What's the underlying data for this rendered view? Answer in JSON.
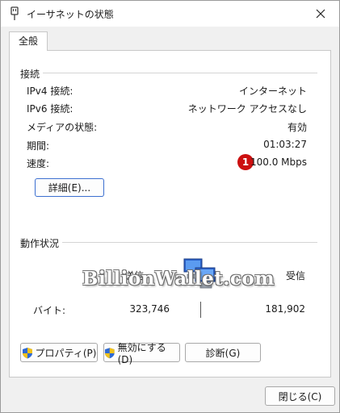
{
  "window": {
    "title": "イーサネットの状態"
  },
  "tabs": [
    {
      "label": "全般"
    }
  ],
  "connection": {
    "heading": "接続",
    "rows": [
      {
        "label": "IPv4 接続:",
        "value": "インターネット"
      },
      {
        "label": "IPv6 接続:",
        "value": "ネットワーク アクセスなし"
      },
      {
        "label": "メディアの状態:",
        "value": "有効"
      },
      {
        "label": "期間:",
        "value": "01:03:27"
      },
      {
        "label": "速度:",
        "value": "100.0 Mbps"
      }
    ],
    "badge": "1",
    "details_button": "詳細(E)..."
  },
  "activity": {
    "heading": "動作状況",
    "sent_label": "送信",
    "received_label": "受信",
    "bytes_label": "バイト:",
    "sent_value": "323,746",
    "received_value": "181,902"
  },
  "watermark": "BillionWallet.com",
  "buttons": {
    "properties": "プロパティ(P)",
    "disable": "無効にする(D)",
    "diagnose": "診断(G)",
    "close": "閉じる(C)"
  },
  "icons": {
    "window": "ethernet-plug-icon",
    "properties_shield": "uac-shield-icon",
    "disable_shield": "uac-shield-icon",
    "network": "network-computers-icon"
  }
}
